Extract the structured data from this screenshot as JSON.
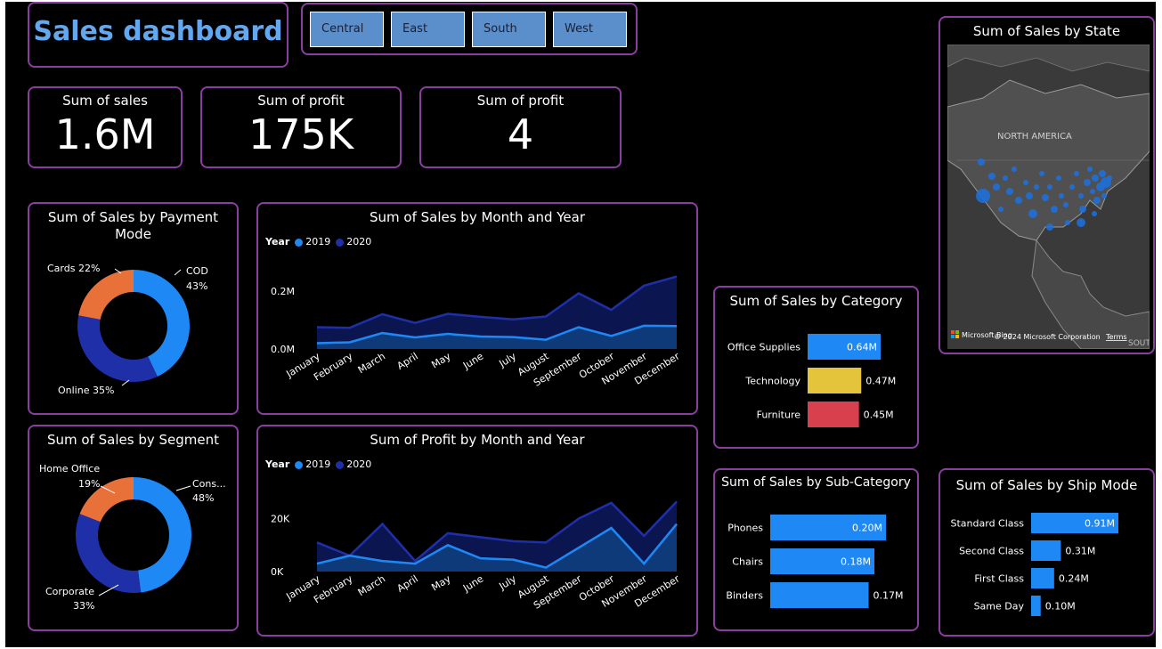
{
  "title": "Sales dashboard",
  "regions": [
    "Central",
    "East",
    "South",
    "West"
  ],
  "kpis": [
    {
      "label": "Sum of sales",
      "value": "1.6M"
    },
    {
      "label": "Sum of profit",
      "value": "175K"
    },
    {
      "label": "Sum of profit",
      "value": "4"
    }
  ],
  "colors": {
    "accent": "#1e88f5",
    "dark_blue": "#1f2fa8",
    "orange": "#e8713a",
    "yellow": "#e3c43a",
    "red": "#d8404e",
    "border": "#8a3f9f",
    "slicer": "#5a8fcc"
  },
  "payment": {
    "title_line1": "Sum of Sales by Payment",
    "title_line2": "Mode",
    "labels": {
      "cards": "Cards 22%",
      "cod": "COD",
      "cod_pct": "43%",
      "online": "Online 35%"
    }
  },
  "segment": {
    "title": "Sum of Sales by Segment",
    "labels": {
      "home": "Home Office",
      "home_pct": "19%",
      "cons": "Cons...",
      "cons_pct": "48%",
      "corp": "Corporate",
      "corp_pct": "33%"
    }
  },
  "legend": {
    "title": "Year",
    "y1": "2019",
    "y2": "2020"
  },
  "map": {
    "title": "Sum of Sales by State",
    "region_label": "NORTH AMERICA",
    "brand": "Microsoft Bing",
    "copyright": "© 2024 Microsoft Corporation",
    "terms": "Terms",
    "partial": "SOUT"
  },
  "chart_data": [
    {
      "id": "payment",
      "type": "pie",
      "title": "Sum of Sales by Payment Mode",
      "categories": [
        "COD",
        "Online",
        "Cards"
      ],
      "values": [
        43,
        35,
        22
      ],
      "colors": [
        "#1e88f5",
        "#1f2fa8",
        "#e8713a"
      ]
    },
    {
      "id": "segment",
      "type": "pie",
      "title": "Sum of Sales by Segment",
      "categories": [
        "Consumer",
        "Corporate",
        "Home Office"
      ],
      "values": [
        48,
        33,
        19
      ],
      "colors": [
        "#1e88f5",
        "#1f2fa8",
        "#e8713a"
      ]
    },
    {
      "id": "sales_month",
      "type": "area",
      "title": "Sum of Sales by Month and Year",
      "categories": [
        "January",
        "February",
        "March",
        "April",
        "May",
        "June",
        "July",
        "August",
        "September",
        "October",
        "November",
        "December"
      ],
      "series": [
        {
          "name": "2019",
          "values": [
            0.02,
            0.023,
            0.055,
            0.04,
            0.052,
            0.043,
            0.041,
            0.032,
            0.075,
            0.045,
            0.08,
            0.079
          ]
        },
        {
          "name": "2020",
          "values": [
            0.075,
            0.073,
            0.12,
            0.09,
            0.121,
            0.111,
            0.102,
            0.112,
            0.192,
            0.135,
            0.218,
            0.25
          ]
        }
      ],
      "yticks": [
        "0.0M",
        "0.2M"
      ],
      "ylim": [
        0,
        0.27
      ]
    },
    {
      "id": "profit_month",
      "type": "area",
      "title": "Sum of Profit by Month and Year",
      "categories": [
        "January",
        "February",
        "March",
        "April",
        "May",
        "June",
        "July",
        "August",
        "September",
        "October",
        "November",
        "December"
      ],
      "series": [
        {
          "name": "2019",
          "values": [
            3000,
            6000,
            4000,
            3000,
            10000,
            5000,
            4500,
            1500,
            9000,
            16500,
            3000,
            18000
          ]
        },
        {
          "name": "2020",
          "values": [
            11000,
            6000,
            18000,
            4000,
            14500,
            13000,
            11500,
            11000,
            20000,
            26000,
            13500,
            26500
          ]
        }
      ],
      "yticks": [
        "0K",
        "20K"
      ],
      "ylim": [
        0,
        32000
      ]
    },
    {
      "id": "category",
      "type": "bar",
      "title": "Sum of Sales by Category",
      "categories": [
        "Office Supplies",
        "Technology",
        "Furniture"
      ],
      "values": [
        0.64,
        0.47,
        0.45
      ],
      "labels": [
        "0.64M",
        "0.47M",
        "0.45M"
      ],
      "colors": [
        "#1e88f5",
        "#e3c43a",
        "#d8404e"
      ],
      "xlim": [
        0,
        0.64
      ]
    },
    {
      "id": "subcategory",
      "type": "bar",
      "title": "Sum of Sales by Sub-Category",
      "categories": [
        "Phones",
        "Chairs",
        "Binders"
      ],
      "values": [
        0.2,
        0.18,
        0.17
      ],
      "labels": [
        "0.20M",
        "0.18M",
        "0.17M"
      ],
      "xlim": [
        0,
        0.2
      ]
    },
    {
      "id": "shipmode",
      "type": "bar",
      "title": "Sum of Sales by Ship Mode",
      "categories": [
        "Standard Class",
        "Second Class",
        "First Class",
        "Same Day"
      ],
      "values": [
        0.91,
        0.31,
        0.24,
        0.1
      ],
      "labels": [
        "0.91M",
        "0.31M",
        "0.24M",
        "0.10M"
      ],
      "xlim": [
        0,
        0.91
      ]
    }
  ]
}
